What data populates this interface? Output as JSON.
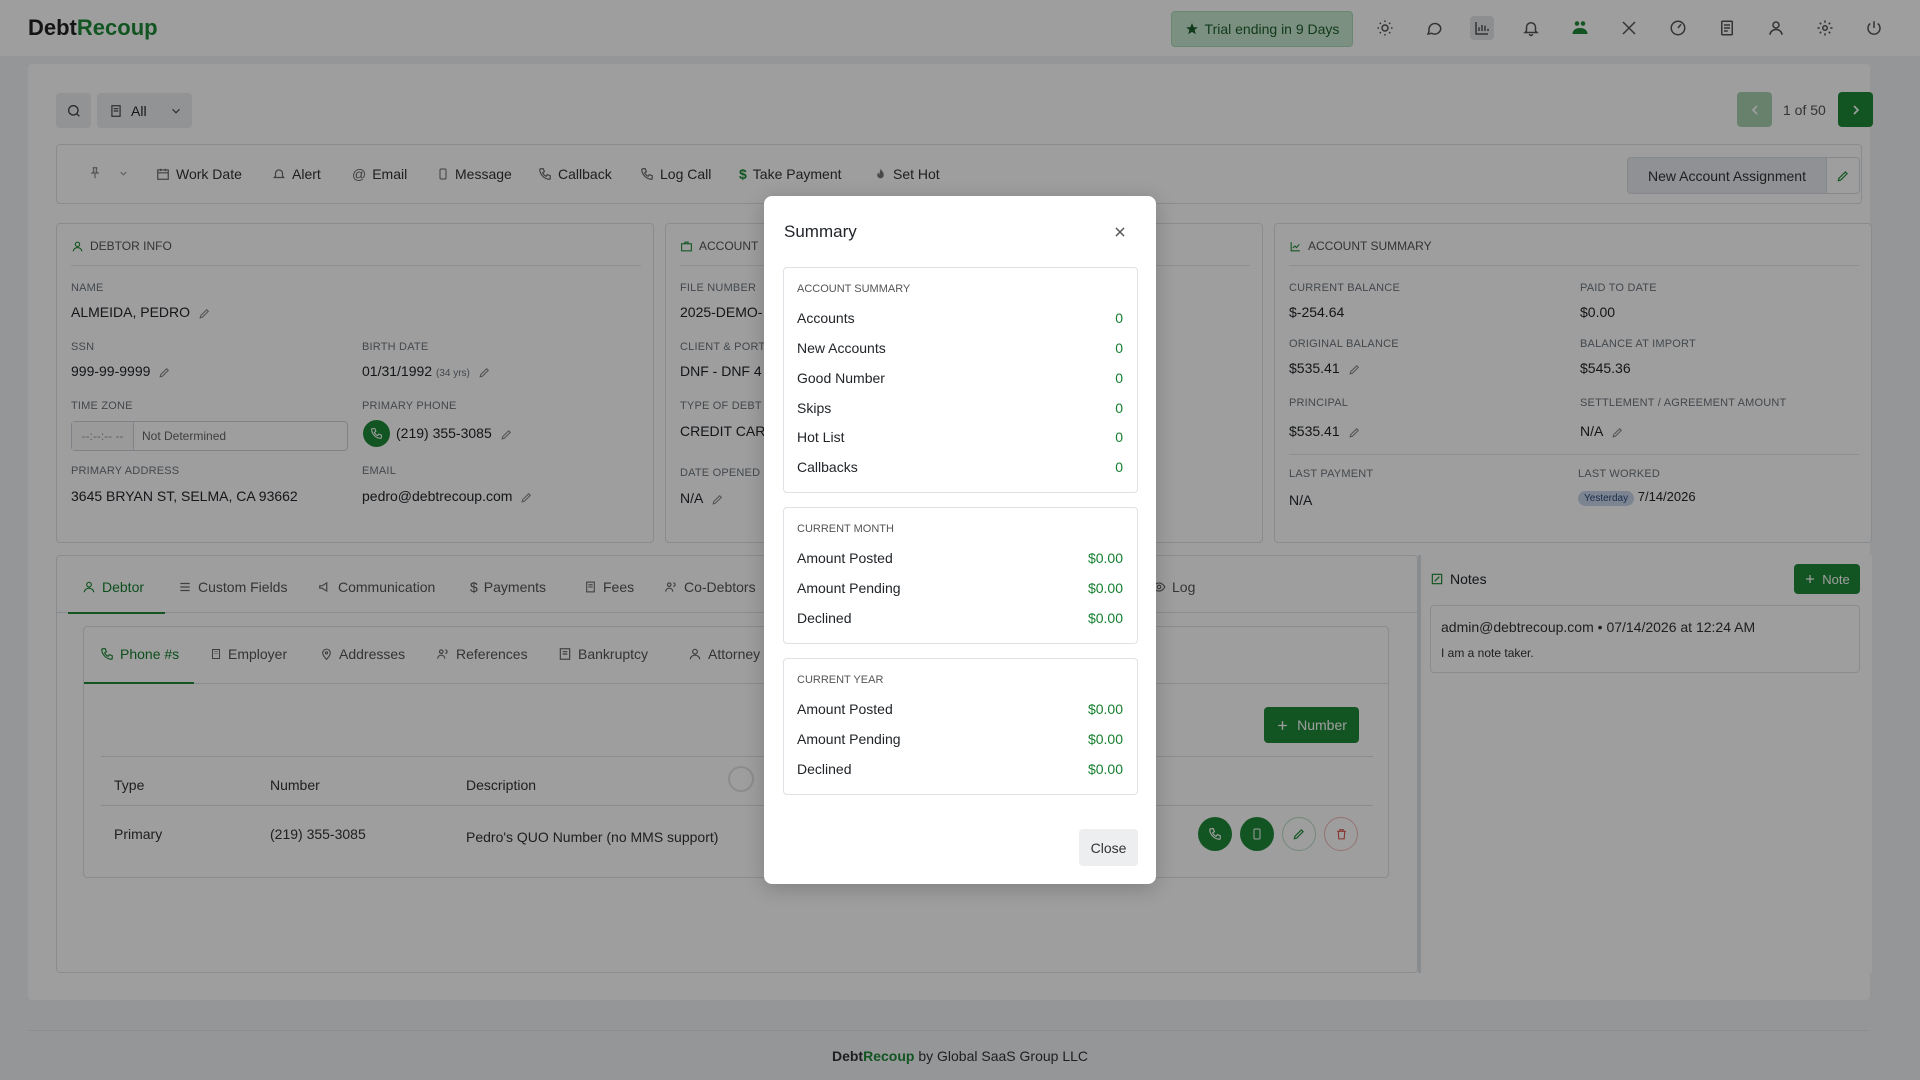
{
  "header": {
    "logo_a": "Debt",
    "logo_b": "Recoup",
    "trial": "Trial ending in 9 Days",
    "icons": [
      "sun-icon",
      "chat-icon",
      "chart-icon",
      "bell-icon",
      "handshake-icon",
      "tools-icon",
      "dashboard-icon",
      "report-icon",
      "user-icon",
      "gear-icon",
      "power-icon"
    ]
  },
  "search": {
    "filter": "All"
  },
  "pager": {
    "text": "1 of 50"
  },
  "actions": {
    "work_date": "Work Date",
    "alert": "Alert",
    "email": "Email",
    "message": "Message",
    "callback": "Callback",
    "log_call": "Log Call",
    "take_payment": "Take Payment",
    "set_hot": "Set Hot",
    "new_assignment": "New Account Assignment"
  },
  "debtor": {
    "title": "DEBTOR INFO",
    "name_label": "NAME",
    "name": "ALMEIDA, PEDRO",
    "ssn_label": "SSN",
    "ssn": "999-99-9999",
    "birth_label": "BIRTH DATE",
    "birth": "01/31/1992",
    "age": "(34 yrs)",
    "tz_label": "TIME ZONE",
    "tz_time": "--:--:-- --",
    "tz_value": "Not Determined",
    "phone_label": "PRIMARY PHONE",
    "phone": "(219) 355-3085",
    "address_label": "PRIMARY ADDRESS",
    "address": "3645 BRYAN ST, SELMA, CA 93662",
    "email_label": "EMAIL",
    "email": "pedro@debtrecoup.com"
  },
  "account": {
    "title": "ACCOUNT",
    "file_label": "FILE NUMBER",
    "file": "2025-DEMO-",
    "client_label": "CLIENT & PORTF",
    "client": "DNF - DNF 4",
    "type_label": "TYPE OF DEBT",
    "type": "CREDIT CARD",
    "opened_label": "DATE OPENED",
    "opened": "N/A"
  },
  "summary_panel": {
    "title": "ACCOUNT SUMMARY",
    "cur_bal_label": "CURRENT BALANCE",
    "cur_bal": "$-254.64",
    "paid_label": "PAID TO DATE",
    "paid": "$0.00",
    "orig_label": "ORIGINAL BALANCE",
    "orig": "$535.41",
    "import_label": "BALANCE AT IMPORT",
    "import": "$545.36",
    "principal_label": "PRINCIPAL",
    "principal": "$535.41",
    "settle_label": "SETTLEMENT / AGREEMENT AMOUNT",
    "settle": "N/A",
    "last_pay_label": "LAST PAYMENT",
    "last_pay": "N/A",
    "last_worked_label": "LAST WORKED",
    "last_worked_badge": "Yesterday",
    "last_worked": "7/14/2026"
  },
  "tabs": [
    "Debtor",
    "Custom Fields",
    "Communication",
    "Payments",
    "Fees",
    "Co-Debtors",
    "Log"
  ],
  "subtabs": [
    "Phone #s",
    "Employer",
    "Addresses",
    "References",
    "Bankruptcy",
    "Attorney"
  ],
  "phones": {
    "add_label": "Number",
    "columns": [
      "Type",
      "Number",
      "Description"
    ],
    "rows": [
      {
        "type": "Primary",
        "number": "(219) 355-3085",
        "description": "Pedro's QUO Number (no MMS support)"
      }
    ]
  },
  "notes": {
    "title": "Notes",
    "add_label": "Note",
    "items": [
      {
        "author": "admin@debtrecoup.com",
        "sep": "•",
        "date": "07/14/2026 at 12:24 AM",
        "text": "I am a note taker."
      }
    ]
  },
  "footer": {
    "brand_a": "Debt",
    "brand_b": "Recoup",
    "by": "by Global SaaS Group LLC"
  },
  "modal": {
    "title": "Summary",
    "close": "Close",
    "account_summary": {
      "heading": "ACCOUNT SUMMARY",
      "rows": [
        {
          "label": "Accounts",
          "value": "0"
        },
        {
          "label": "New Accounts",
          "value": "0"
        },
        {
          "label": "Good Number",
          "value": "0"
        },
        {
          "label": "Skips",
          "value": "0"
        },
        {
          "label": "Hot List",
          "value": "0"
        },
        {
          "label": "Callbacks",
          "value": "0"
        }
      ]
    },
    "current_month": {
      "heading": "CURRENT MONTH",
      "rows": [
        {
          "label": "Amount Posted",
          "value": "$0.00"
        },
        {
          "label": "Amount Pending",
          "value": "$0.00"
        },
        {
          "label": "Declined",
          "value": "$0.00"
        }
      ]
    },
    "current_year": {
      "heading": "CURRENT YEAR",
      "rows": [
        {
          "label": "Amount Posted",
          "value": "$0.00"
        },
        {
          "label": "Amount Pending",
          "value": "$0.00"
        },
        {
          "label": "Declined",
          "value": "$0.00"
        }
      ]
    }
  },
  "colors": {
    "brand": "#1e8a37",
    "accent_text": "#157f2f"
  }
}
